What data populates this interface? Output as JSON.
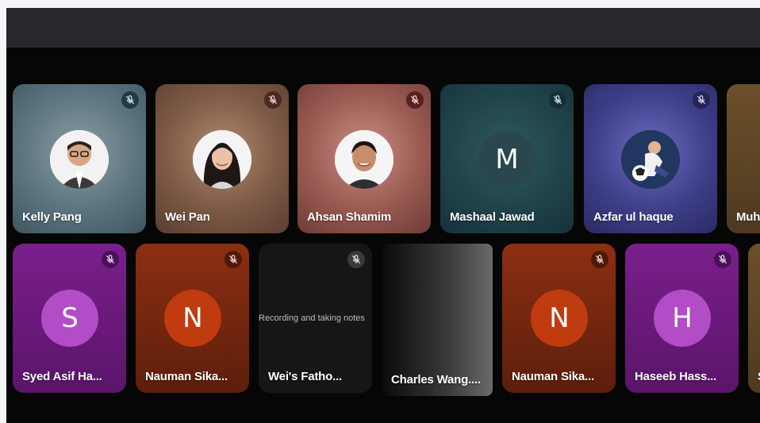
{
  "window": {
    "topbar_color": "#26282b",
    "background": "#060606"
  },
  "participants": [
    {
      "id": "kelly",
      "name": "Kelly Pang",
      "avatar_type": "photo",
      "muted": true
    },
    {
      "id": "wei",
      "name": "Wei Pan",
      "avatar_type": "photo",
      "muted": true
    },
    {
      "id": "ahsan",
      "name": "Ahsan Shamim",
      "avatar_type": "photo",
      "muted": true
    },
    {
      "id": "mashaal",
      "name": "Mashaal Jawad",
      "avatar_type": "letter",
      "initial": "M",
      "muted": true
    },
    {
      "id": "azfar",
      "name": "Azfar ul haque",
      "avatar_type": "photo",
      "muted": true
    },
    {
      "id": "muh",
      "name": "Muh",
      "avatar_type": "hidden",
      "muted": false
    },
    {
      "id": "syed",
      "name": "Syed Asif Ha...",
      "avatar_type": "letter",
      "initial": "S",
      "muted": true
    },
    {
      "id": "nauman1",
      "name": "Nauman Sika...",
      "avatar_type": "letter",
      "initial": "N",
      "muted": true
    },
    {
      "id": "fathom",
      "name": "Wei's Fatho...",
      "avatar_type": "screen",
      "screen_text": "Recording and taking notes",
      "muted": true
    },
    {
      "id": "charles",
      "name": "Charles Wang....",
      "avatar_type": "none",
      "muted": false
    },
    {
      "id": "nauman2",
      "name": "Nauman Sika...",
      "avatar_type": "letter",
      "initial": "N",
      "muted": true
    },
    {
      "id": "haseeb",
      "name": "Haseeb Hass...",
      "avatar_type": "letter",
      "initial": "H",
      "muted": true
    },
    {
      "id": "s-partial",
      "name": "S",
      "avatar_type": "hidden",
      "muted": false
    }
  ],
  "icons": {
    "mic_off": "mic-off-icon"
  },
  "colors": {
    "purple": "#8e24aa",
    "orange": "#d84315",
    "teal": "#2b4b52"
  }
}
